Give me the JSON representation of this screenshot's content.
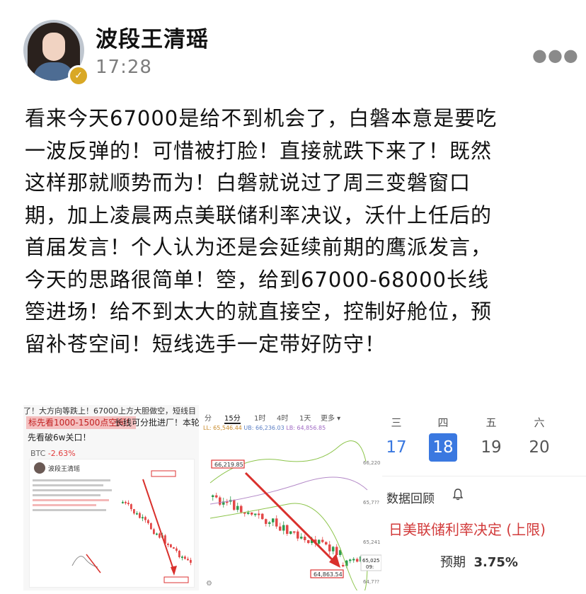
{
  "header": {
    "author_name": "波段王清瑶",
    "time": "17:28",
    "verified_icon": "check-badge-icon",
    "more_icon": "more-dots-icon"
  },
  "post": {
    "lines": [
      "看来今天67000是给不到机会了，白磐本意是要吃",
      "一波反弹的！可惜被打脸！直接就跌下来了！既然",
      "这样那就顺势而为！白磐就说过了周三变磐窗口",
      "期，加上凌晨两点美联储利率决议，沃什上任后的",
      "首届发言！个人认为还是会延续前期的鹰派发言，",
      "今天的思路很简单！箜，给到67000-68000长线",
      "箜进场！给不到太大的就直接空，控制好舱位，预",
      "留补苍空间！短线选手一定带好防守！"
    ]
  },
  "image1": {
    "top_text": "了！大方向等跌上！67000上方大胆做空，短线目",
    "highlight": "标先看1000-1500点空间！",
    "after_highlight": "长线可分批进厂！本轮",
    "line4": "先看破6w关口！",
    "ticker": "BTC",
    "change": "-2.63%",
    "card_name": "波段王清瑶",
    "price_tag_top": "66,2??",
    "price_tag_bottom": "64,???"
  },
  "image2": {
    "tabs": [
      "分",
      "15分",
      "1时",
      "4时",
      "1天",
      "更多 ▾"
    ],
    "active_tab": "15分",
    "stats": {
      "a": "LL: 65,546.44",
      "b": "UB: 66,236.03",
      "c": "LB: 64,856.85"
    },
    "price_top": "66,219.85",
    "price_bottom": "64,863.54",
    "axis": [
      "66,220",
      "65,7??",
      "65,241",
      "64,7??"
    ],
    "last_price": "65,025",
    "last_price_sub": "09:"
  },
  "image3": {
    "weekdays": [
      "三",
      "四",
      "五",
      "六"
    ],
    "days": [
      "17",
      "18",
      "19",
      "20"
    ],
    "selected_day": "18",
    "review_label": "数据回顾",
    "event_title": "日美联储利率决定 (上限)",
    "forecast_label": "预期",
    "forecast_value": "3.75%"
  },
  "colors": {
    "up": "#2e9c4f",
    "down": "#e34848",
    "selected_day": "#3a78e0",
    "event": "#d23b3b"
  }
}
